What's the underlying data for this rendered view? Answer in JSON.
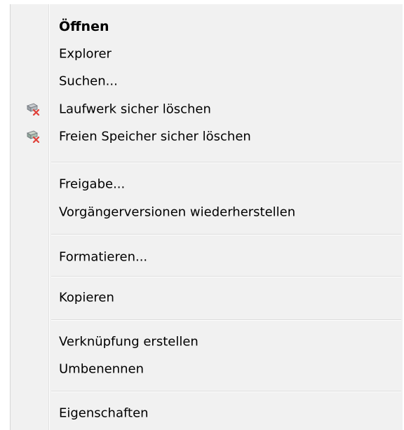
{
  "menu": {
    "items": [
      {
        "label": "Öffnen"
      },
      {
        "label": "Explorer"
      },
      {
        "label": "Suchen..."
      },
      {
        "label": "Laufwerk sicher löschen",
        "icon": "secure-erase-drive-icon"
      },
      {
        "label": "Freien Speicher sicher löschen",
        "icon": "secure-erase-free-space-icon"
      },
      {
        "label": "Freigabe..."
      },
      {
        "label": "Vorgängerversionen wiederherstellen"
      },
      {
        "label": "Formatieren..."
      },
      {
        "label": "Kopieren"
      },
      {
        "label": "Verknüpfung erstellen"
      },
      {
        "label": "Umbenennen"
      },
      {
        "label": "Eigenschaften"
      }
    ]
  }
}
